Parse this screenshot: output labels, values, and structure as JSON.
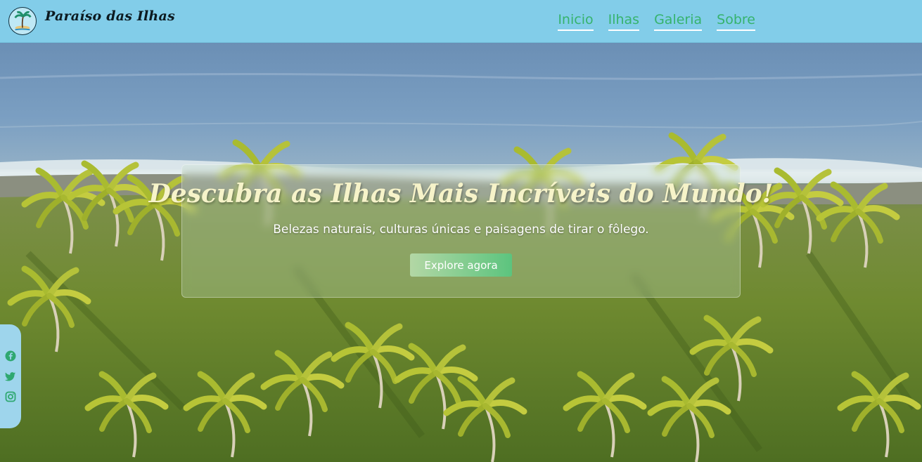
{
  "header": {
    "brand": "Paraíso das Ilhas",
    "logo_icon": "palm-island-icon",
    "nav": [
      {
        "label": "Inicio"
      },
      {
        "label": "Ilhas"
      },
      {
        "label": "Galeria"
      },
      {
        "label": "Sobre"
      }
    ]
  },
  "hero": {
    "title": "Descubra as Ilhas Mais Incríveis do Mundo!",
    "subtitle": "Belezas naturais, culturas únicas e paisagens de tirar o fôlego.",
    "cta_label": "Explore agora",
    "background": "aerial-beach-palm-trees-image"
  },
  "social": {
    "icons": [
      "facebook-icon",
      "twitter-icon",
      "instagram-icon"
    ]
  },
  "colors": {
    "header_bg": "#82cde9",
    "nav_link": "#36b36d",
    "title_text": "#f6f3c9",
    "cta_start": "#b3d7a5",
    "cta_end": "#5cc47e",
    "social_bar": "#9ed5ec",
    "social_icon": "#2fa870"
  }
}
